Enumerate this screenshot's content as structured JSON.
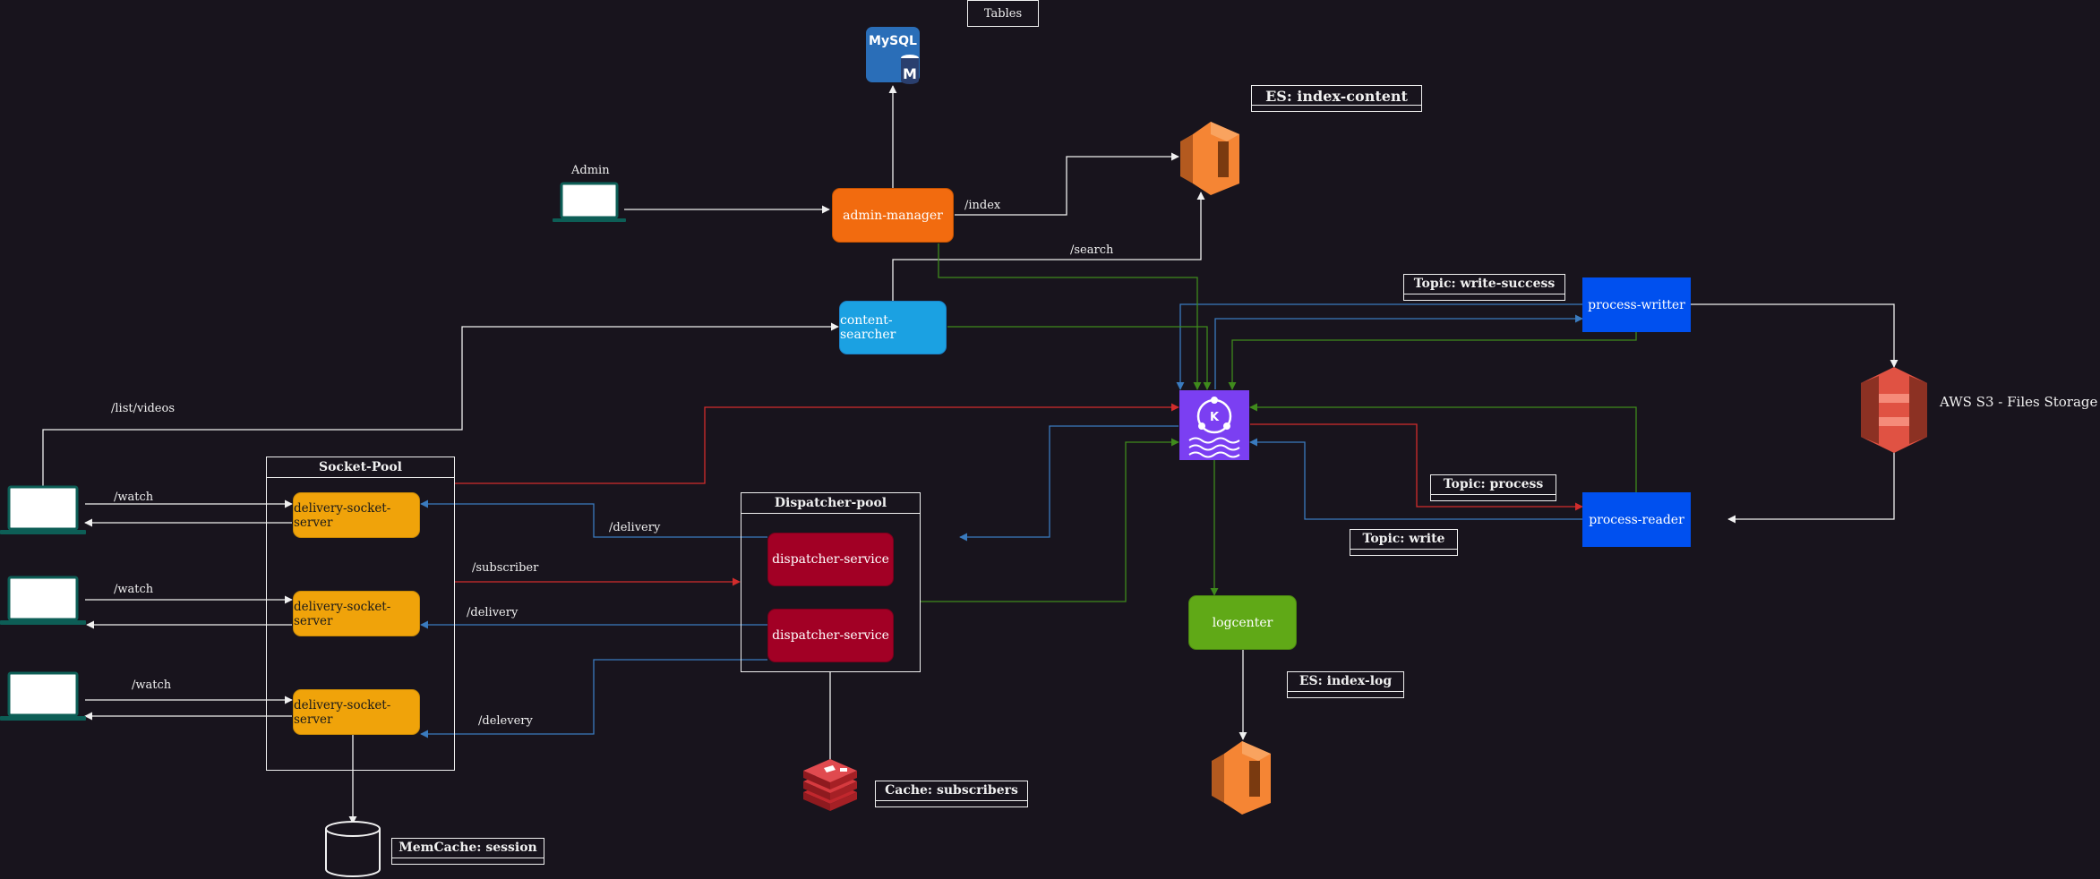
{
  "labels": {
    "admin": "Admin",
    "tables": "Tables",
    "index": "/index",
    "search": "/search",
    "list_videos": "/list/videos",
    "watch_1": "/watch",
    "watch_2": "/watch",
    "watch_3": "/watch",
    "delivery_1": "/delivery",
    "delivery_2": "/delivery",
    "delivery_3": "/delevery",
    "subscriber": "/subscriber",
    "s3": "AWS S3 - Files Storage"
  },
  "nodes": {
    "admin_manager": "admin-manager",
    "content_searcher": "content-searcher",
    "process_writter": "process-writter",
    "process_reader": "process-reader",
    "logcenter": "logcenter",
    "dispatcher_1": "dispatcher-service",
    "dispatcher_2": "dispatcher-service",
    "delivery_1": "delivery-socket-server",
    "delivery_2": "delivery-socket-server",
    "delivery_3": "delivery-socket-server"
  },
  "pools": {
    "socket_pool": "Socket-Pool",
    "dispatcher_pool": "Dispatcher-pool"
  },
  "tags": {
    "es_content": "ES: index-content",
    "es_log": "ES: index-log",
    "topic_write_success": "Topic: write-success",
    "topic_process": "Topic: process",
    "topic_write": "Topic: write",
    "cache_subscribers": "Cache: subscribers",
    "memcache_session": "MemCache: session"
  },
  "icons": {
    "mysql_text": "MySQL",
    "mysql_badge": "M",
    "kafka_badge": "K"
  },
  "colors": {
    "background": "#18141d",
    "white_wire": "#f0f0f0",
    "red_wire": "#d12c2c",
    "blue_wire": "#3a7bbf",
    "green_wire": "#3f8a1c",
    "kafka": "#7b3ff2",
    "aws_orange": "#f58534",
    "redis": "#c1272d",
    "mysql": "#2a6eb8"
  }
}
